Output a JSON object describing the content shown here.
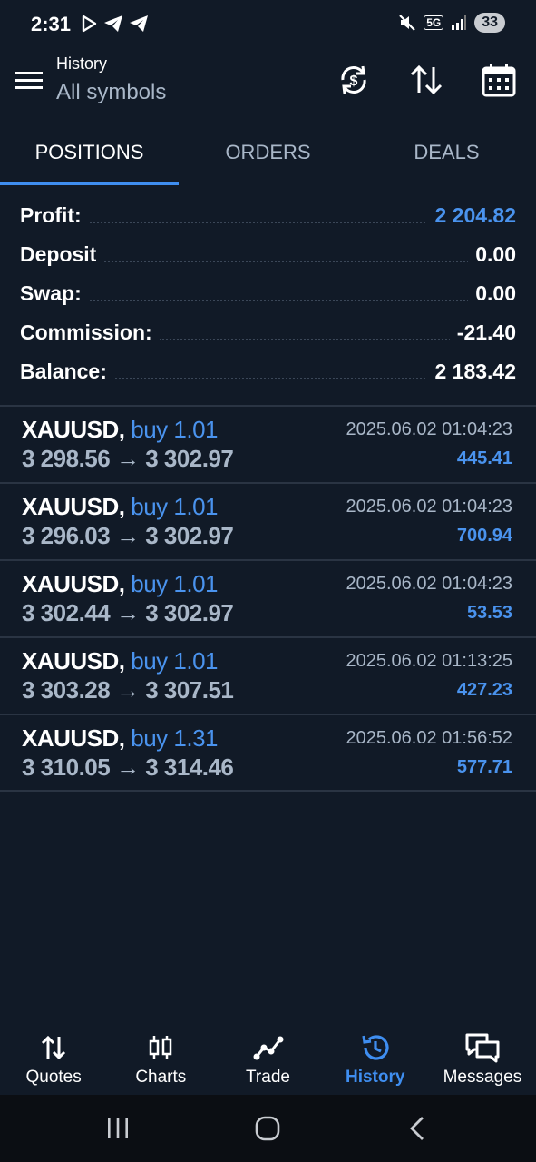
{
  "status_bar": {
    "time": "2:31",
    "network": "5G",
    "battery": "33"
  },
  "header": {
    "subtitle": "History",
    "title": "All symbols"
  },
  "toolbar_icons": [
    "sync-icon",
    "sort-icon",
    "calendar-icon"
  ],
  "tabs": [
    {
      "label": "POSITIONS",
      "active": true
    },
    {
      "label": "ORDERS",
      "active": false
    },
    {
      "label": "DEALS",
      "active": false
    }
  ],
  "summary": [
    {
      "label": "Profit:",
      "value": "2 204.82"
    },
    {
      "label": "Deposit",
      "value": "0.00"
    },
    {
      "label": "Swap:",
      "value": "0.00"
    },
    {
      "label": "Commission:",
      "value": "-21.40"
    },
    {
      "label": "Balance:",
      "value": "2 183.42"
    }
  ],
  "positions": [
    {
      "symbol": "XAUUSD,",
      "type": "buy 1.01",
      "open": "3 298.56",
      "arrow": "→",
      "close": "3 302.97",
      "time": "2025.06.02 01:04:23",
      "profit": "445.41"
    },
    {
      "symbol": "XAUUSD,",
      "type": "buy 1.01",
      "open": "3 296.03",
      "arrow": "→",
      "close": "3 302.97",
      "time": "2025.06.02 01:04:23",
      "profit": "700.94"
    },
    {
      "symbol": "XAUUSD,",
      "type": "buy 1.01",
      "open": "3 302.44",
      "arrow": "→",
      "close": "3 302.97",
      "time": "2025.06.02 01:04:23",
      "profit": "53.53"
    },
    {
      "symbol": "XAUUSD,",
      "type": "buy 1.01",
      "open": "3 303.28",
      "arrow": "→",
      "close": "3 307.51",
      "time": "2025.06.02 01:13:25",
      "profit": "427.23"
    },
    {
      "symbol": "XAUUSD,",
      "type": "buy 1.31",
      "open": "3 310.05",
      "arrow": "→",
      "close": "3 314.46",
      "time": "2025.06.02 01:56:52",
      "profit": "577.71"
    }
  ],
  "bottom_nav": [
    {
      "label": "Quotes",
      "icon": "quotes-arrows-icon",
      "active": false
    },
    {
      "label": "Charts",
      "icon": "candlestick-icon",
      "active": false
    },
    {
      "label": "Trade",
      "icon": "trade-line-icon",
      "active": false
    },
    {
      "label": "History",
      "icon": "history-clock-icon",
      "active": true
    },
    {
      "label": "Messages",
      "icon": "messages-icon",
      "active": false
    }
  ],
  "colors": {
    "background": "#111a27",
    "accent": "#3f8ef0",
    "muted": "#a9b7c8"
  }
}
